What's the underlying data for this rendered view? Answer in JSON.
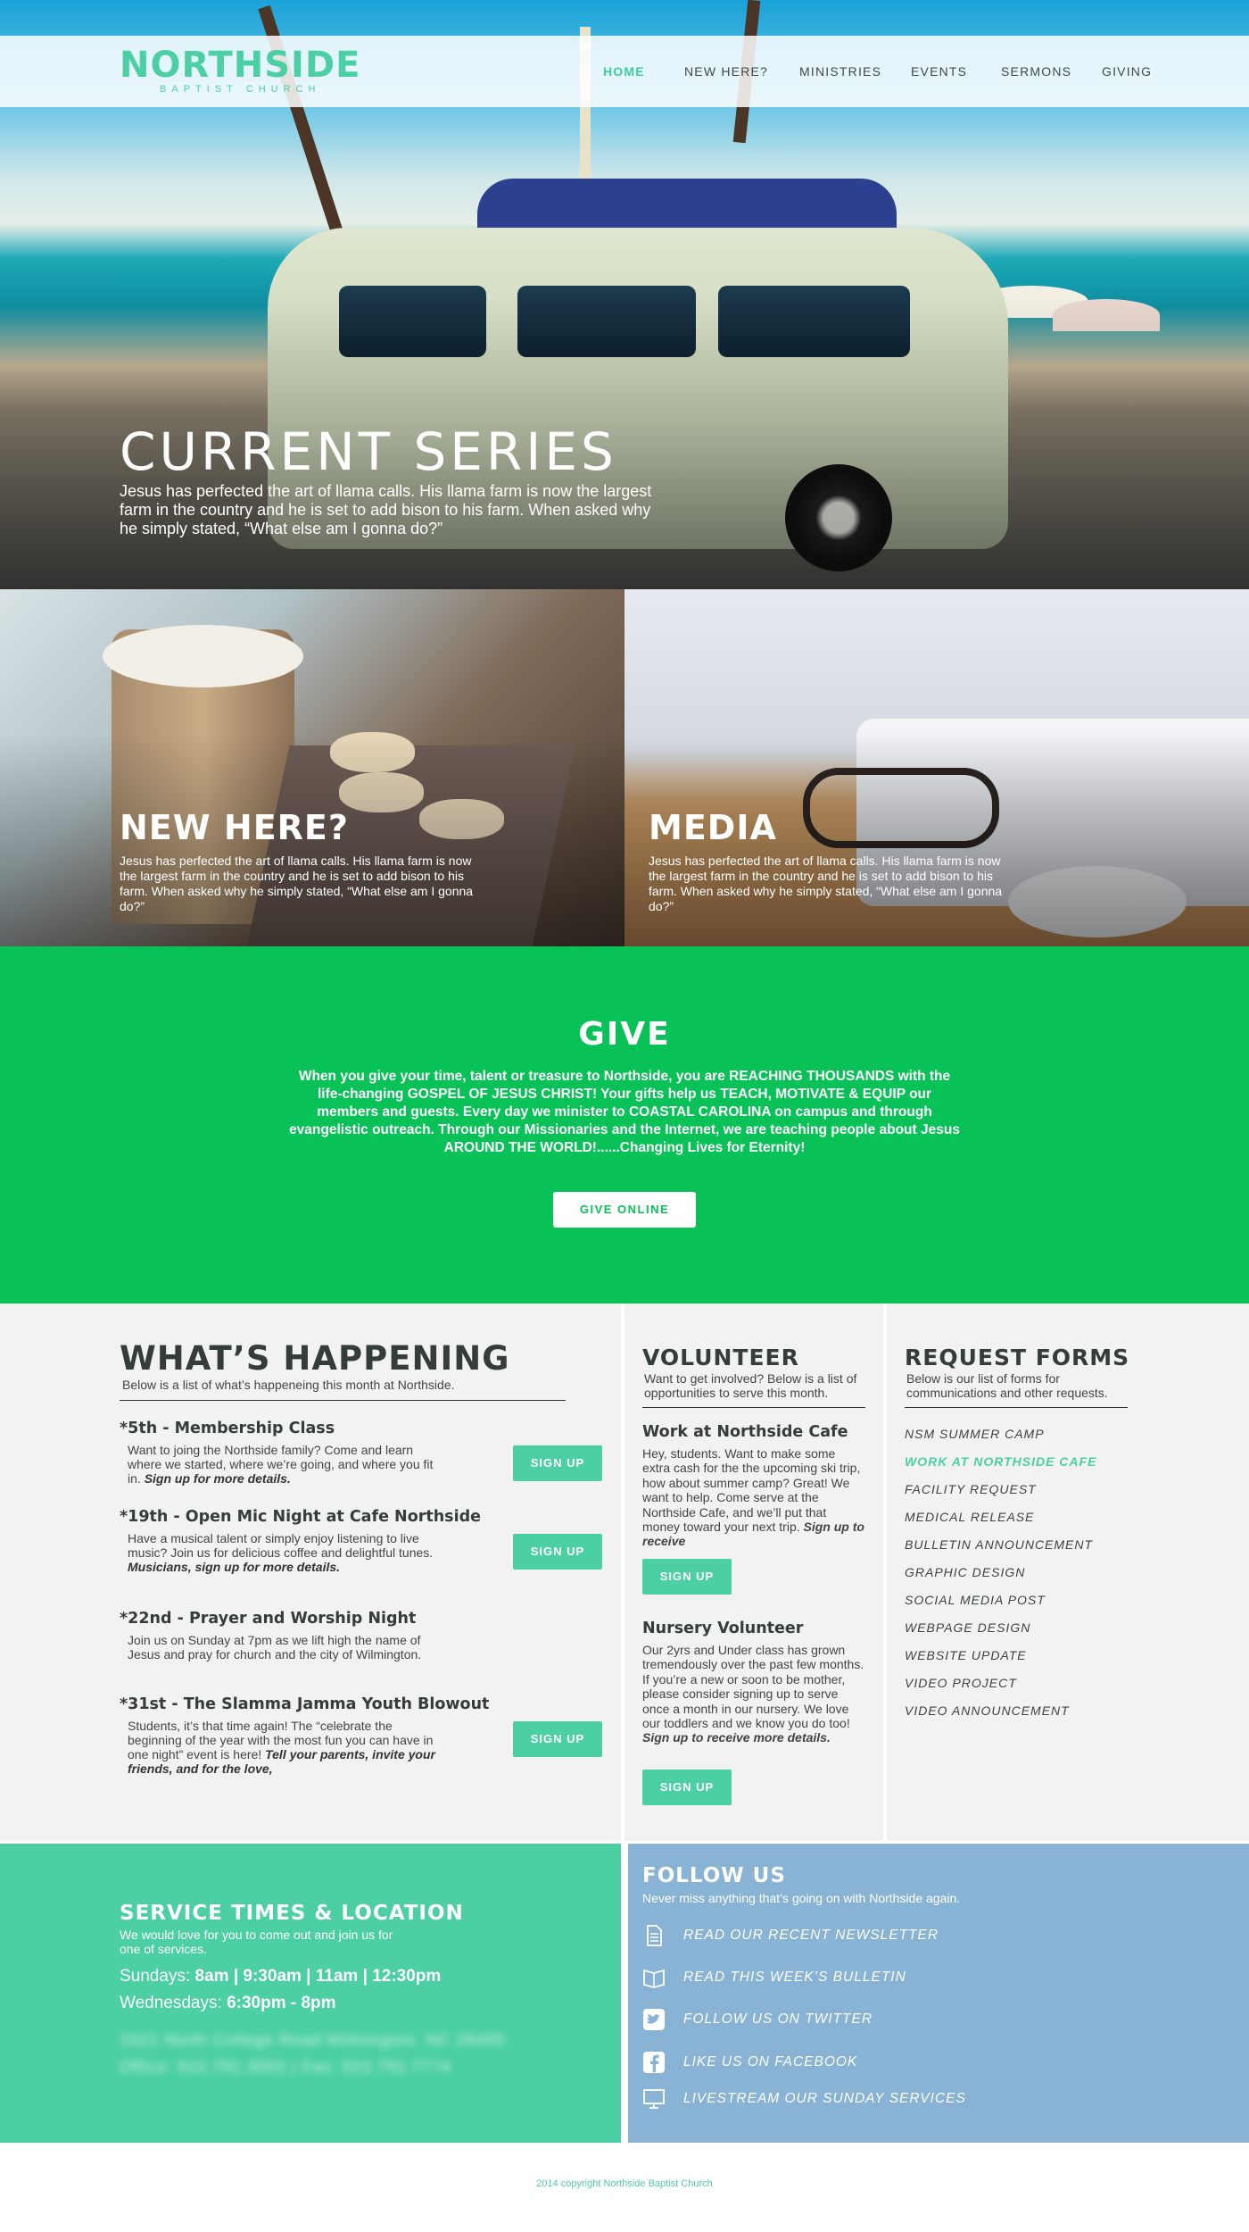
{
  "brand": {
    "name": "NORTHSIDE",
    "subtitle": "BAPTIST CHURCH",
    "accent": "#4bcfa3",
    "green": "#08c157",
    "blue": "#89b3d4"
  },
  "nav": {
    "items": [
      "HOME",
      "NEW HERE?",
      "MINISTRIES",
      "EVENTS",
      "SERMONS",
      "GIVING"
    ],
    "active": "HOME"
  },
  "hero": {
    "title": "CURRENT SERIES",
    "text": "Jesus has perfected the art of llama calls. His llama farm is now the largest farm in the country and he is set to add bison to his farm. When asked why he simply stated, “What else am I gonna do?”"
  },
  "tiles": [
    {
      "title": "NEW HERE?",
      "text": "Jesus has perfected the art of llama calls. His llama farm is now the largest farm in the country and he is set to add bison to his farm. When asked why he simply stated, “What else am I gonna do?”"
    },
    {
      "title": "MEDIA",
      "text": "Jesus has perfected the art of llama calls. His llama farm is now the largest farm in the country and he is set to add bison to his farm. When asked why he simply stated, “What else am I gonna do?”"
    }
  ],
  "give": {
    "title": "GIVE",
    "text": "When you give your time, talent or treasure to Northside, you are REACHING THOUSANDS with the life-changing GOSPEL OF JESUS CHRIST! Your gifts help us TEACH, MOTIVATE & EQUIP our members and guests. Every day we minister to COASTAL CAROLINA on campus and through evangelistic outreach. Through our Missionaries and the Internet, we are teaching people about Jesus AROUND THE WORLD!......Changing Lives for Eternity!",
    "button": "GIVE ONLINE"
  },
  "happening": {
    "title": "WHAT’S HAPPENING",
    "subtitle": "Below is a list of what’s happeneing this month at Northside.",
    "signup_label": "SIGN UP",
    "events": [
      {
        "title": "*5th - Membership Class",
        "text": "Want to joing the Northside family? Come and learn where we started, where we’re going, and where you fit in.",
        "emph": "Sign up for more details."
      },
      {
        "title": "*19th - Open Mic Night at Cafe Northside",
        "text": "Have a musical talent or simply enjoy listening to live music? Join us for delicious coffee and delightful tunes.",
        "emph": "Musicians, sign up for more details."
      },
      {
        "title": "*22nd - Prayer and Worship Night",
        "text": "Join us on Sunday at 7pm as we lift high the name of Jesus and pray for church and the city of Wilmington.",
        "emph": ""
      },
      {
        "title": "*31st - The Slamma Jamma Youth Blowout",
        "text": "Students, it’s that time again! The “celebrate the beginning of the year with the most fun you can have in one night” event is here!",
        "emph": "Tell your parents, invite your friends, and for the love,"
      }
    ]
  },
  "volunteer": {
    "title": "VOLUNTEER",
    "subtitle": "Want to get involved? Below is a list of opportunities to serve this month.",
    "roles": [
      {
        "title": "Work at Northside Cafe",
        "text": "Hey, students. Want to make some extra cash for the the upcoming ski trip, how about summer camp? Great! We want to help. Come serve at the Northside Cafe, and we’ll put that money toward your next trip.",
        "emph": "Sign up to receive"
      },
      {
        "title": "Nursery Volunteer",
        "text": "Our 2yrs and Under class has grown tremendously over the past few months. If you’re a new or soon to be mother, please consider signing up to serve once a month in our nursery. We love our toddlers and we know you do too!",
        "emph": "Sign up to receive more details."
      }
    ]
  },
  "forms": {
    "title": "REQUEST FORMS",
    "subtitle": "Below is our list of forms for communications and other requests.",
    "items": [
      "NSM SUMMER CAMP",
      "WORK AT NORTHSIDE CAFE",
      "FACILITY REQUEST",
      "MEDICAL RELEASE",
      "BULLETIN ANNOUNCEMENT",
      "GRAPHIC DESIGN",
      "SOCIAL MEDIA POST",
      "WEBPAGE DESIGN",
      "WEBSITE UPDATE",
      "VIDEO PROJECT",
      "VIDEO ANNOUNCEMENT"
    ],
    "highlighted": "WORK AT NORTHSIDE CAFE"
  },
  "service": {
    "title": "SERVICE TIMES & LOCATION",
    "subtitle": "We would love for you to come out and join us for one of services.",
    "sundays_label": "Sundays:",
    "sundays_times": "8am | 9:30am | 11am | 12:30pm",
    "wednesdays_label": "Wednesdays:",
    "wednesdays_times": "6:30pm - 8pm",
    "address_blurred": "1021 North College Road Wilmington, NC 28405",
    "phone_blurred": "Office: 910.791.3003 | Fax: 910.791.7774"
  },
  "follow": {
    "title": "FOLLOW US",
    "subtitle": "Never miss anything that’s going on with Northside again.",
    "links": [
      {
        "icon": "document-icon",
        "label": "READ OUR RECENT NEWSLETTER"
      },
      {
        "icon": "bulletin-icon",
        "label": "READ THIS WEEK’S BULLETIN"
      },
      {
        "icon": "twitter-icon",
        "label": "FOLLOW US ON TWITTER"
      },
      {
        "icon": "facebook-icon",
        "label": "LIKE US ON FACEBOOK"
      },
      {
        "icon": "monitor-icon",
        "label": "LIVESTREAM OUR SUNDAY SERVICES"
      }
    ]
  },
  "footer": {
    "copyright": "2014 copyright Northside Baptist Church"
  }
}
